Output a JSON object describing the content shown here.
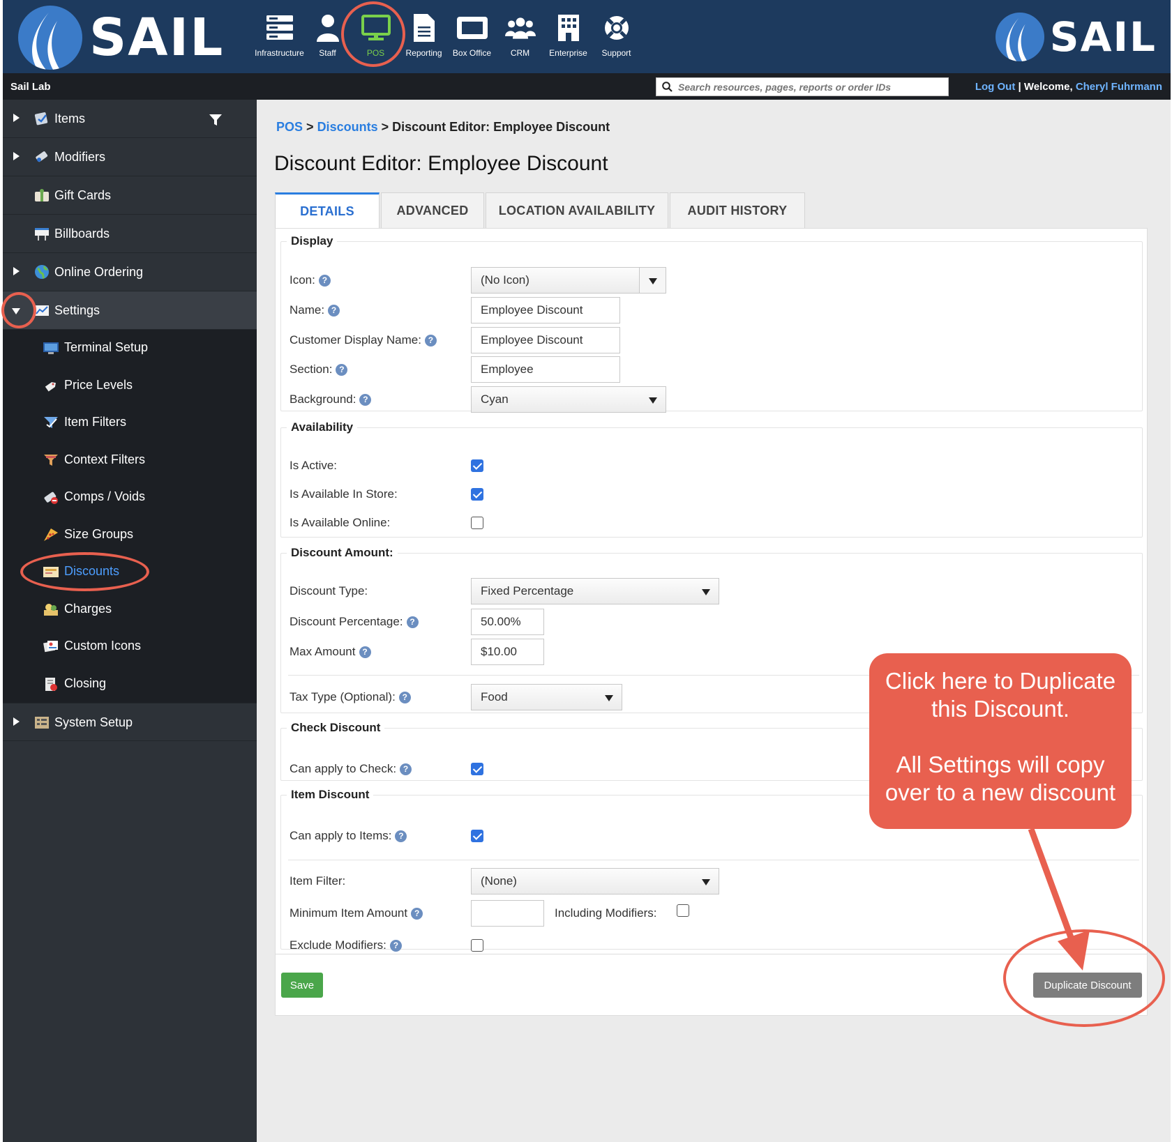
{
  "brand": {
    "name": "SAIL"
  },
  "topnav": [
    {
      "label": "Infrastructure",
      "icon": "server-icon"
    },
    {
      "label": "Staff",
      "icon": "person-icon"
    },
    {
      "label": "POS",
      "icon": "monitor-icon",
      "active": true
    },
    {
      "label": "Reporting",
      "icon": "document-icon"
    },
    {
      "label": "Box Office",
      "icon": "ticket-icon"
    },
    {
      "label": "CRM",
      "icon": "users-icon"
    },
    {
      "label": "Enterprise",
      "icon": "building-icon"
    },
    {
      "label": "Support",
      "icon": "lifebuoy-icon"
    }
  ],
  "subbar": {
    "org": "Sail Lab",
    "search_placeholder": "Search resources, pages, reports or order IDs",
    "logout": "Log Out",
    "separator": "|",
    "welcome": "Welcome,",
    "user": "Cheryl Fuhrmann"
  },
  "sidebar": {
    "top": [
      {
        "label": "Items",
        "icon": "items-icon"
      },
      {
        "label": "Modifiers",
        "icon": "modifiers-icon"
      },
      {
        "label": "Gift Cards",
        "icon": "gift-card-icon"
      },
      {
        "label": "Billboards",
        "icon": "billboard-icon"
      },
      {
        "label": "Online Ordering",
        "icon": "globe-icon"
      },
      {
        "label": "Settings",
        "icon": "settings-icon"
      }
    ],
    "settings_children": [
      {
        "label": "Terminal Setup",
        "icon": "terminal-icon"
      },
      {
        "label": "Price Levels",
        "icon": "price-tag-icon"
      },
      {
        "label": "Item Filters",
        "icon": "item-filter-icon"
      },
      {
        "label": "Context Filters",
        "icon": "context-filter-icon"
      },
      {
        "label": "Comps / Voids",
        "icon": "comps-icon"
      },
      {
        "label": "Size Groups",
        "icon": "pizza-icon"
      },
      {
        "label": "Discounts",
        "icon": "discount-icon",
        "selected": true
      },
      {
        "label": "Charges",
        "icon": "charges-icon"
      },
      {
        "label": "Custom Icons",
        "icon": "custom-icons-icon"
      },
      {
        "label": "Closing",
        "icon": "closing-icon"
      }
    ],
    "bottom": [
      {
        "label": "System Setup",
        "icon": "system-setup-icon"
      }
    ]
  },
  "breadcrumb": {
    "pos": "POS",
    "sep1": ">",
    "discounts": "Discounts",
    "sep2": ">",
    "current": "Discount Editor: Employee Discount"
  },
  "page_title": "Discount Editor: Employee Discount",
  "tabs": [
    "DETAILS",
    "ADVANCED",
    "LOCATION AVAILABILITY",
    "AUDIT HISTORY"
  ],
  "form": {
    "display": {
      "legend": "Display",
      "icon_label": "Icon:",
      "icon_value": "(No Icon)",
      "name_label": "Name:",
      "name_value": "Employee Discount",
      "cust_label": "Customer Display Name:",
      "cust_value": "Employee Discount",
      "section_label": "Section:",
      "section_value": "Employee",
      "bg_label": "Background:",
      "bg_value": "Cyan"
    },
    "availability": {
      "legend": "Availability",
      "active_label": "Is Active:",
      "active": true,
      "store_label": "Is Available In Store:",
      "store": true,
      "online_label": "Is Available Online:",
      "online": false
    },
    "amount": {
      "legend": "Discount Amount:",
      "type_label": "Discount Type:",
      "type_value": "Fixed Percentage",
      "pct_label": "Discount Percentage:",
      "pct_value": "50.00%",
      "max_label": "Max Amount",
      "max_value": "$10.00",
      "tax_label": "Tax Type (Optional):",
      "tax_value": "Food"
    },
    "check": {
      "legend": "Check Discount",
      "apply_label": "Can apply to Check:",
      "apply": true
    },
    "item": {
      "legend": "Item Discount",
      "apply_label": "Can apply to Items:",
      "apply": true,
      "filter_label": "Item Filter:",
      "filter_value": "(None)",
      "min_label": "Minimum Item Amount",
      "min_value": "",
      "incl_label": "Including Modifiers:",
      "incl": false,
      "excl_label": "Exclude Modifiers:",
      "excl": false
    }
  },
  "buttons": {
    "save": "Save",
    "duplicate": "Duplicate Discount"
  },
  "help_glyph": "?",
  "annotation": {
    "line1": "Click here to Duplicate",
    "line2": "this Discount.",
    "line3": "All Settings will copy",
    "line4": "over to a new discount"
  },
  "colors": {
    "header": "#1d3a5e",
    "accent": "#2a7ee0",
    "active_nav": "#7ad04b",
    "annotation": "#e8604f",
    "save": "#4aa64a"
  }
}
